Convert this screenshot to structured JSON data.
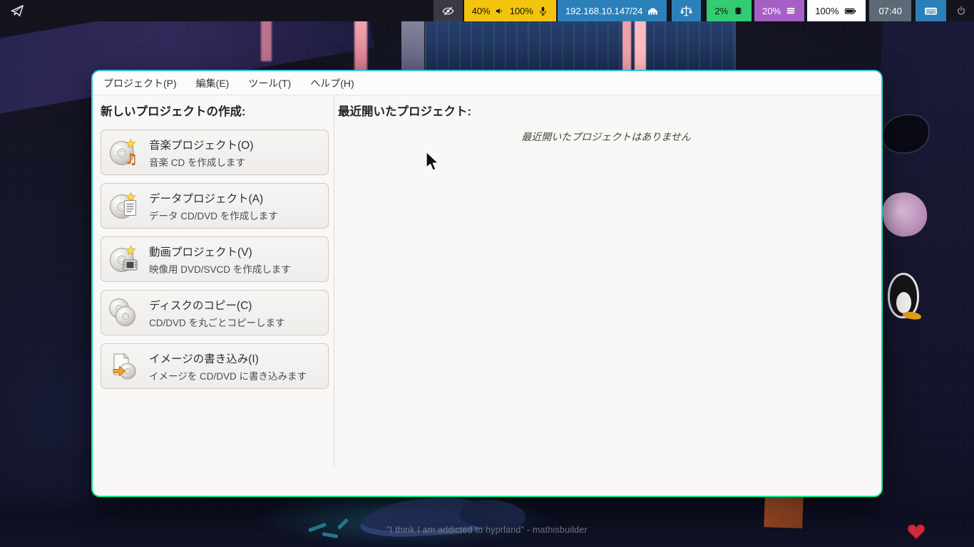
{
  "topbar": {
    "launcher": {
      "icon": "paper-plane-icon"
    },
    "idle_inhibitor": {
      "icon": "eye-slash-icon"
    },
    "audio": {
      "volume": "40%",
      "mic": "100%"
    },
    "network": {
      "label": "192.168.10.147/24",
      "icon": "ethernet-icon"
    },
    "scale": {
      "icon": "scale-icon"
    },
    "cpu": {
      "label": "2%",
      "icon": "microchip-icon"
    },
    "memory": {
      "label": "20%",
      "icon": "memory-bars-icon"
    },
    "battery": {
      "label": "100%",
      "icon": "battery-icon"
    },
    "clock": {
      "label": "07:40"
    },
    "keyboard": {
      "icon": "keyboard-icon"
    },
    "power": {
      "icon": "power-icon"
    }
  },
  "window": {
    "menu": [
      "プロジェクト(P)",
      "編集(E)",
      "ツール(T)",
      "ヘルプ(H)"
    ],
    "left_panel": {
      "heading": "新しいプロジェクトの作成:",
      "buttons": [
        {
          "icon": "audio-project-icon",
          "title": "音楽プロジェクト(O)",
          "subtitle": "音楽 CD を作成します"
        },
        {
          "icon": "data-project-icon",
          "title": "データプロジェクト(A)",
          "subtitle": "データ CD/DVD を作成します"
        },
        {
          "icon": "video-project-icon",
          "title": "動画プロジェクト(V)",
          "subtitle": "映像用 DVD/SVCD を作成します"
        },
        {
          "icon": "disc-copy-icon",
          "title": "ディスクのコピー(C)",
          "subtitle": "CD/DVD を丸ごとコピーします"
        },
        {
          "icon": "burn-image-icon",
          "title": "イメージの書き込み(I)",
          "subtitle": "イメージを CD/DVD に書き込みます"
        }
      ]
    },
    "right_panel": {
      "heading": "最近開いたプロジェクト:",
      "empty_message": "最近開いたプロジェクトはありません"
    }
  },
  "desktop": {
    "quote": "\"I think I am addicted to hyprland\" - mathisbuilder"
  },
  "colors": {
    "bar_background": "#14141d",
    "audio_module": "#f2c40e",
    "network_module": "#2c80ba",
    "cpu_module": "#33cc73",
    "memory_module": "#a55fc5",
    "battery_module": "#fdfdfd",
    "clock_module": "#5c6a78",
    "window_border_top": "#38c6de",
    "window_border_bottom": "#0be98e",
    "window_background": "#f9f8f6"
  }
}
